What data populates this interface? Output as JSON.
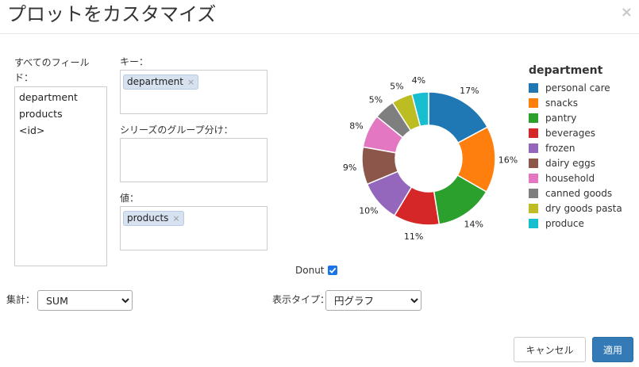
{
  "dialog": {
    "title": "プロットをカスタマイズ",
    "close_label": "×"
  },
  "fields": {
    "label": "すべてのフィールド：",
    "items": [
      "department",
      "products",
      "<id>"
    ]
  },
  "keys": {
    "label": "キー：",
    "chip": "department",
    "chip_remove": "×"
  },
  "series_group": {
    "label": "シリーズのグループ分け："
  },
  "values": {
    "label": "値：",
    "chip": "products",
    "chip_remove": "×"
  },
  "donut": {
    "label": "Donut",
    "checked": true
  },
  "aggregation": {
    "label": "集計：",
    "selected": "SUM"
  },
  "display_type": {
    "label": "表示タイプ：",
    "selected": "円グラフ"
  },
  "buttons": {
    "cancel": "キャンセル",
    "apply": "適用"
  },
  "chart_data": {
    "type": "pie",
    "donut": true,
    "legend_title": "department",
    "legend_position": "right",
    "categories": [
      "personal care",
      "snacks",
      "pantry",
      "beverages",
      "frozen",
      "dairy eggs",
      "household",
      "canned goods",
      "dry goods pasta",
      "produce"
    ],
    "values": [
      17,
      16,
      14,
      11,
      10,
      9,
      8,
      5,
      5,
      4
    ],
    "labels": [
      "17%",
      "16%",
      "14%",
      "11%",
      "10%",
      "9%",
      "8%",
      "5%",
      "5%",
      "4%"
    ],
    "colors": [
      "#1f77b4",
      "#ff7f0e",
      "#2ca02c",
      "#d62728",
      "#9467bd",
      "#8c564b",
      "#e377c2",
      "#7f7f7f",
      "#bcbd22",
      "#17becf"
    ]
  }
}
